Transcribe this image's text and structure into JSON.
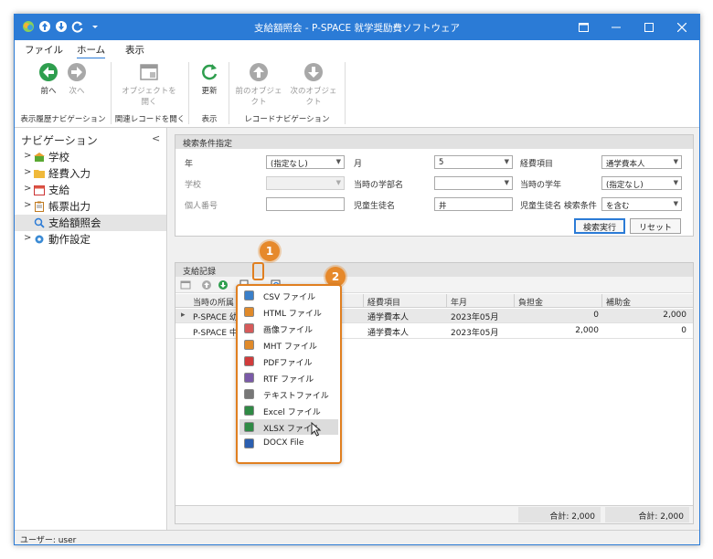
{
  "window": {
    "title": "支給額照会 - P-SPACE 就学奨励費ソフトウェア"
  },
  "menubar": {
    "items": [
      "ファイル",
      "ホーム",
      "表示"
    ],
    "active": "ホーム"
  },
  "ribbon": {
    "back": "前へ",
    "forward": "次へ",
    "open_object": "オブジェクトを開く",
    "refresh": "更新",
    "prev_object": "前のオブジェクト",
    "next_object": "次のオブジェクト",
    "groups": [
      "表示履歴ナビゲーション",
      "関連レコードを開く",
      "表示",
      "レコードナビゲーション"
    ]
  },
  "nav": {
    "title": "ナビゲーション",
    "items": [
      {
        "label": "学校",
        "expandable": true,
        "icon": "school-icon"
      },
      {
        "label": "経費入力",
        "expandable": true,
        "icon": "folder-icon"
      },
      {
        "label": "支給",
        "expandable": true,
        "icon": "calendar-icon"
      },
      {
        "label": "帳票出力",
        "expandable": true,
        "icon": "clipboard-icon"
      },
      {
        "label": "支給額照会",
        "expandable": false,
        "icon": "search-icon",
        "selected": true
      },
      {
        "label": "動作設定",
        "expandable": true,
        "icon": "gear-icon"
      }
    ]
  },
  "search": {
    "header": "検索条件指定",
    "labels": {
      "year": "年",
      "month": "月",
      "expense": "経費項目",
      "school": "学校",
      "faculty": "当時の学部名",
      "grade": "当時の学年",
      "personal_no": "個人番号",
      "student_name": "児童生徒名",
      "name_cond": "児童生徒名 検索条件"
    },
    "values": {
      "year": "(指定なし)",
      "month": "5",
      "expense": "通学費本人",
      "school": "",
      "faculty": "",
      "grade": "(指定なし)",
      "personal_no": "",
      "student_name": "井",
      "name_cond": "を含む"
    },
    "search_button": "検索実行",
    "reset_button": "リセット"
  },
  "records": {
    "header": "支給記録",
    "columns": [
      "当時の所属",
      "経費項目",
      "年月",
      "負担金",
      "補助金"
    ],
    "rows": [
      [
        "P-SPACE 幼",
        "通学費本人",
        "2023年05月",
        "0",
        "2,000"
      ],
      [
        "P-SPACE 中",
        "通学費本人",
        "2023年05月",
        "2,000",
        "0"
      ]
    ],
    "totals": [
      "合計: 2,000",
      "合計: 2,000"
    ]
  },
  "export_menu": {
    "items": [
      {
        "label": "CSV ファイル",
        "color": "#3a7fc9"
      },
      {
        "label": "HTML ファイル",
        "color": "#e08a2a"
      },
      {
        "label": "画像ファイル",
        "color": "#d65a5a"
      },
      {
        "label": "MHT ファイル",
        "color": "#e08a2a"
      },
      {
        "label": "PDFファイル",
        "color": "#d13b3b"
      },
      {
        "label": "RTF ファイル",
        "color": "#7a5aa8"
      },
      {
        "label": "テキストファイル",
        "color": "#777777"
      },
      {
        "label": "Excel ファイル",
        "color": "#2f8a45"
      },
      {
        "label": "XLSX ファイル",
        "color": "#2f8a45",
        "hover": true
      },
      {
        "label": "DOCX File",
        "color": "#2b5fb0"
      }
    ]
  },
  "callouts": [
    "1",
    "2"
  ],
  "status": {
    "user": "ユーザー: user"
  }
}
